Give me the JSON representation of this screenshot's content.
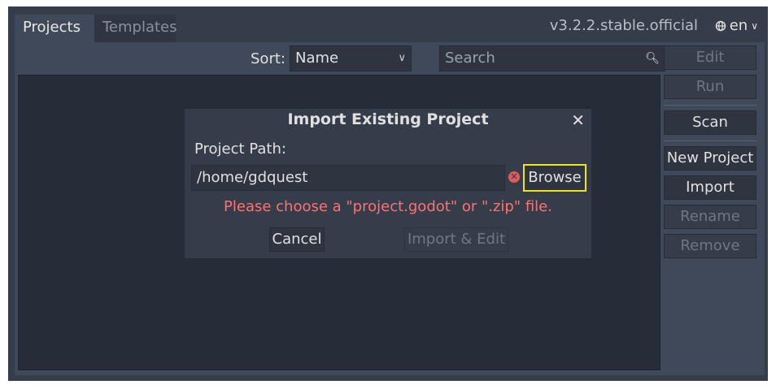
{
  "tabs": [
    {
      "label": "Projects",
      "active": true
    },
    {
      "label": "Templates",
      "active": false
    }
  ],
  "version": "v3.2.2.stable.official",
  "language": {
    "label": "en",
    "icon": "globe-icon"
  },
  "toolbar": {
    "sort_label": "Sort:",
    "sort_value": "Name",
    "search_placeholder": "Search"
  },
  "sidebar": {
    "edit": "Edit",
    "run": "Run",
    "scan": "Scan",
    "new_project": "New Project",
    "import": "Import",
    "rename": "Rename",
    "remove": "Remove"
  },
  "dialog": {
    "title": "Import Existing Project",
    "path_label": "Project Path:",
    "path_value": "/home/gdquest",
    "browse": "Browse",
    "error": "Please choose a \"project.godot\" or \".zip\" file.",
    "cancel": "Cancel",
    "import_edit": "Import & Edit"
  },
  "colors": {
    "accent_highlight": "#f2e41a",
    "error": "#ff7070",
    "background": "#363d4a"
  }
}
